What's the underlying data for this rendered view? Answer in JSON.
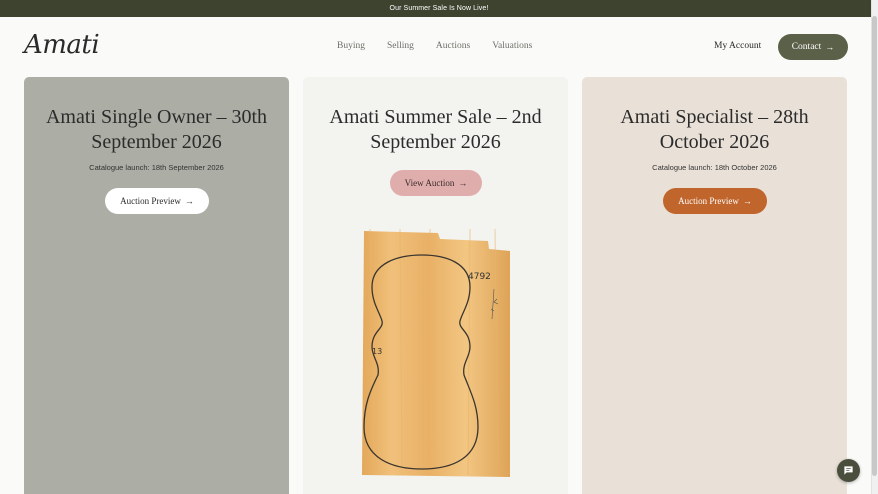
{
  "announcement": "Our Summer Sale Is Now Live!",
  "logo": "Amati",
  "nav": {
    "items": [
      "Buying",
      "Selling",
      "Auctions",
      "Valuations"
    ]
  },
  "account": "My Account",
  "contact": {
    "label": "Contact",
    "arrow": "→"
  },
  "cards": [
    {
      "title": "Amati Single Owner – 30th September 2026",
      "subtitle": "Catalogue launch: 18th September 2026",
      "button": "Auction Preview",
      "arrow": "→"
    },
    {
      "title": "Amati Summer Sale – 2nd September 2026",
      "subtitle": "",
      "button": "View Auction",
      "arrow": "→"
    },
    {
      "title": "Amati Specialist – 28th October 2026",
      "subtitle": "Catalogue launch: 18th October 2026",
      "button": "Auction Preview",
      "arrow": "→"
    }
  ],
  "image_annotations": [
    "4792",
    "13"
  ],
  "colors": {
    "accent": "#5b6049",
    "announce": "#3e4330",
    "card1": "#acada4",
    "card2": "#f3f3f0",
    "card3": "#e9e1d8",
    "orange": "#c0652b",
    "pink": "#dfaeac"
  },
  "icons": {
    "chat": "chat-bubble-icon"
  }
}
